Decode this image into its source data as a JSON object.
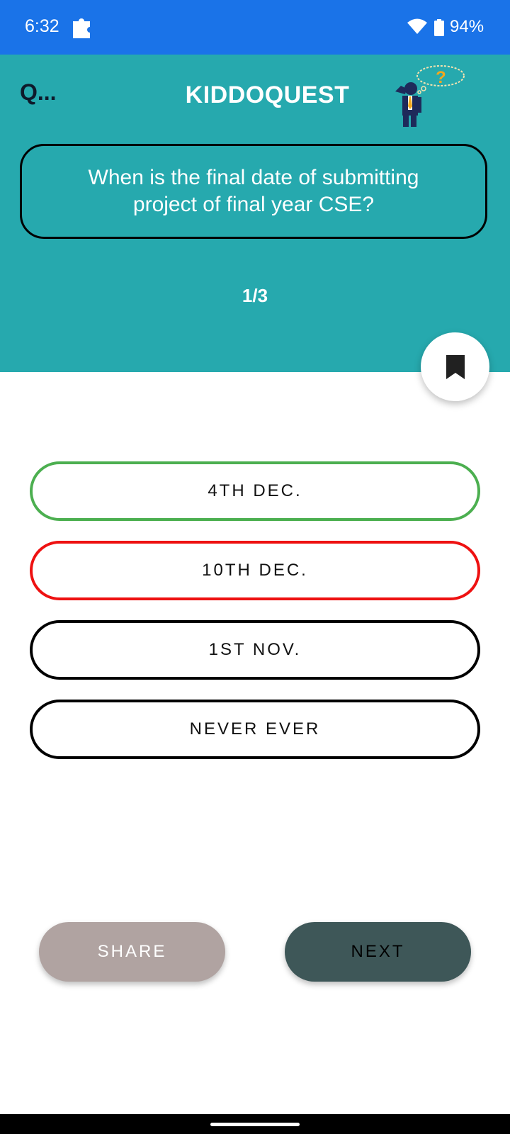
{
  "status_bar": {
    "time": "6:32",
    "battery": "94%",
    "icons": [
      "puzzle-icon",
      "wifi-icon",
      "battery-icon"
    ]
  },
  "header": {
    "back_label": "Q...",
    "title": "KIDDOQUEST",
    "mascot_icon": "thinking-man-icon"
  },
  "question": {
    "text": "When is the final date of submitting project of final year CSE?",
    "counter": "1/3"
  },
  "bookmark": {
    "icon": "bookmark-icon"
  },
  "options": [
    {
      "label": "4TH DEC.",
      "state": "correct",
      "color": "#4CAF50"
    },
    {
      "label": "10TH DEC.",
      "state": "wrong",
      "color": "#EE1111"
    },
    {
      "label": "1ST NOV.",
      "state": "neutral",
      "color": "#000000"
    },
    {
      "label": "NEVER EVER",
      "state": "neutral",
      "color": "#000000"
    }
  ],
  "actions": {
    "share_label": "SHARE",
    "next_label": "NEXT"
  },
  "colors": {
    "status_bar": "#1A73E8",
    "header": "#26A9AE",
    "share_button": "#B0A3A1",
    "next_button": "#3E5758"
  }
}
